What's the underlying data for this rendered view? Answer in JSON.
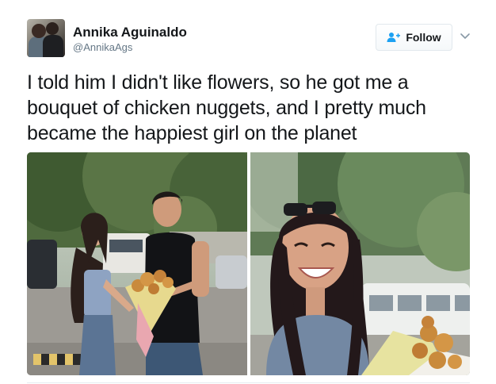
{
  "tweet": {
    "author": {
      "name": "Annika Aguinaldo",
      "handle": "@AnnikaAgs"
    },
    "follow_label": "Follow",
    "text_lines": [
      "I told him I didn't like flowers, so he got me a",
      "bouquet of chicken nuggets, and I pretty much",
      "became the happiest girl on the planet"
    ]
  },
  "icons": {
    "follow": "add-user-icon",
    "caret": "chevron-down-icon"
  },
  "colors": {
    "text": "#14171a",
    "muted": "#657786",
    "accent": "#1da1f2",
    "border": "#e1e8ed"
  }
}
